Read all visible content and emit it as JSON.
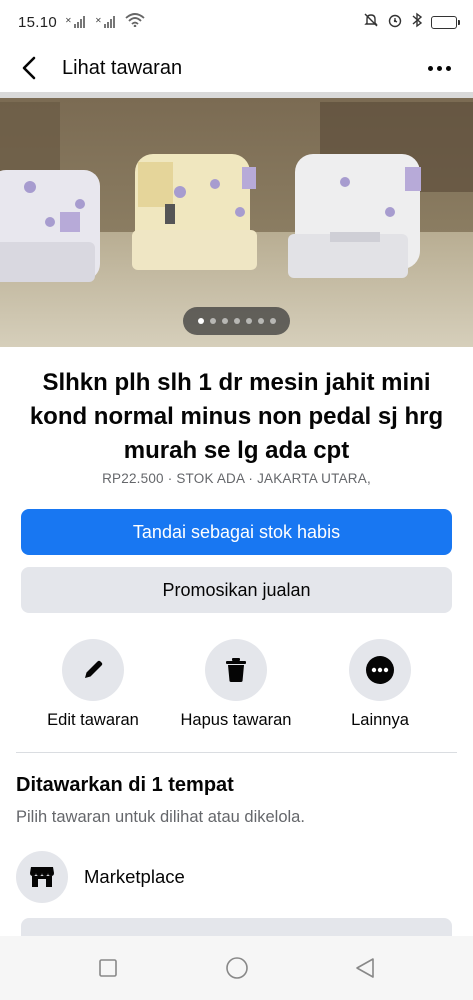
{
  "status_bar": {
    "time": "15.10",
    "icons": [
      "signal-x-icon",
      "signal-x-icon",
      "wifi-icon",
      "mute-icon",
      "alarm-icon",
      "bluetooth-icon",
      "battery-icon"
    ]
  },
  "header": {
    "title": "Lihat tawaran",
    "back_icon": "back-arrow-icon",
    "more_icon": "more-dots-icon"
  },
  "photo": {
    "pager_total": 7,
    "pager_active_index": 0
  },
  "listing": {
    "title": "Slhkn plh slh 1 dr mesin jahit mini kond normal minus non pedal sj hrg murah se lg ada cpt",
    "meta": "RP22.500 · STOK ADA · JAKARTA UTARA,"
  },
  "buttons": {
    "mark_sold": "Tandai sebagai stok habis",
    "promote": "Promosikan jualan"
  },
  "actions": [
    {
      "label": "Edit tawaran",
      "icon": "pencil-icon"
    },
    {
      "label": "Hapus tawaran",
      "icon": "trash-icon"
    },
    {
      "label": "Lainnya",
      "icon": "more-icon"
    }
  ],
  "section": {
    "title": "Ditawarkan di 1 tempat",
    "subtitle": "Pilih tawaran untuk dilihat atau dikelola."
  },
  "places": [
    {
      "label": "Marketplace",
      "icon": "marketplace-shop-icon"
    }
  ],
  "nav": [
    "recent-apps-icon",
    "home-icon",
    "back-icon"
  ],
  "colors": {
    "primary": "#1877f2",
    "secondary_bg": "#e4e6eb",
    "text": "#050505",
    "muted": "#65676b"
  }
}
